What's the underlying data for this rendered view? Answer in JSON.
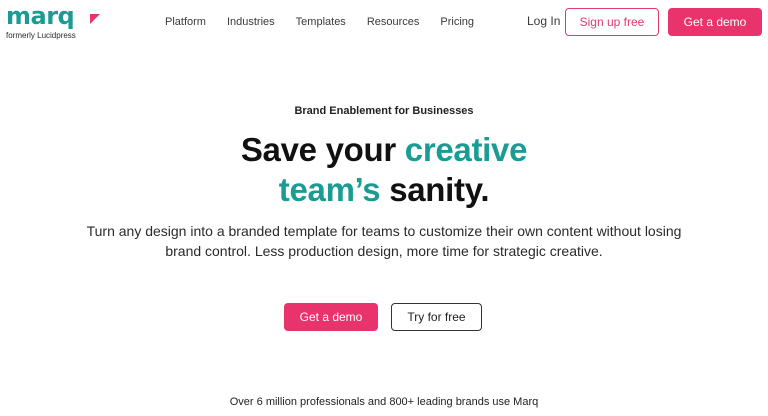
{
  "brand": {
    "logo_text": "marq",
    "logo_subtitle": "formerly Lucidpress",
    "colors": {
      "teal": "#1a9c94",
      "pink": "#e8336c"
    }
  },
  "nav": {
    "items": [
      {
        "label": "Platform"
      },
      {
        "label": "Industries"
      },
      {
        "label": "Templates"
      },
      {
        "label": "Resources"
      },
      {
        "label": "Pricing"
      }
    ]
  },
  "header": {
    "login_label": "Log In",
    "signup_label": "Sign up free",
    "demo_label": "Get a demo"
  },
  "hero": {
    "eyebrow": "Brand Enablement for Businesses",
    "headline_part1": "Save your ",
    "headline_accent1": "creative",
    "headline_accent2": "team’s",
    "headline_part2": " sanity.",
    "lede_line1": "Turn any design into a branded template for teams to customize their own content without losing",
    "lede_line2": "brand control. Less production design, more time for strategic creative.",
    "primary_cta": "Get a demo",
    "secondary_cta": "Try for free"
  },
  "social_proof": {
    "text": "Over 6 million professionals and 800+ leading brands use Marq"
  }
}
